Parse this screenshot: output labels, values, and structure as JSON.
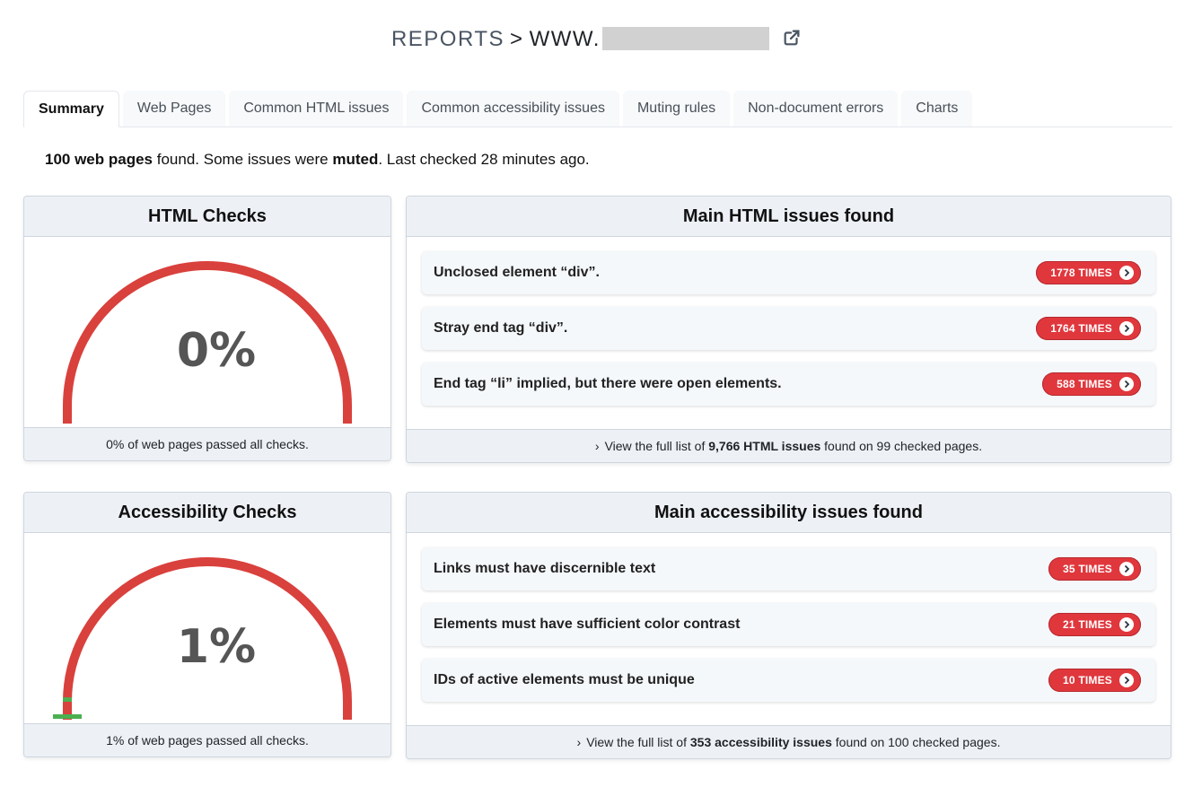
{
  "header": {
    "breadcrumb_root": "REPORTS",
    "separator": ">",
    "host_prefix": "WWW.",
    "external_link_icon": "external-link-icon"
  },
  "tabs": [
    {
      "label": "Summary",
      "active": true
    },
    {
      "label": "Web Pages",
      "active": false
    },
    {
      "label": "Common HTML issues",
      "active": false
    },
    {
      "label": "Common accessibility issues",
      "active": false
    },
    {
      "label": "Muting rules",
      "active": false
    },
    {
      "label": "Non-document errors",
      "active": false
    },
    {
      "label": "Charts",
      "active": false
    }
  ],
  "summary": {
    "pages_count": "100 web pages",
    "found": " found. Some issues were ",
    "muted": "muted",
    "last_checked": ". Last checked 28 minutes ago."
  },
  "colors": {
    "fail": "#d9413d",
    "pass": "#4caf50",
    "badge": "#e0373d",
    "gauge_text": "#555555"
  },
  "html_checks": {
    "title": "HTML Checks",
    "percent_label": "0%",
    "pass_fraction": 0.0,
    "footer": "0% of web pages passed all checks."
  },
  "accessibility_checks": {
    "title": "Accessibility Checks",
    "percent_label": "1%",
    "pass_fraction": 0.01,
    "footer": "1% of web pages passed all checks."
  },
  "html_issues": {
    "title": "Main HTML issues found",
    "items": [
      {
        "text": "Unclosed element “div”.",
        "count": "1778 TIMES"
      },
      {
        "text": "Stray end tag “div”.",
        "count": "1764 TIMES"
      },
      {
        "text": "End tag “li” implied, but there were open elements.",
        "count": "588 TIMES"
      }
    ],
    "footer_prefix": "View the full list of ",
    "footer_bold": "9,766 HTML issues",
    "footer_suffix": " found on 99 checked pages."
  },
  "accessibility_issues": {
    "title": "Main accessibility issues found",
    "items": [
      {
        "text": "Links must have discernible text",
        "count": "35 TIMES"
      },
      {
        "text": "Elements must have sufficient color contrast",
        "count": "21 TIMES"
      },
      {
        "text": "IDs of active elements must be unique",
        "count": "10 TIMES"
      }
    ],
    "footer_prefix": "View the full list of ",
    "footer_bold": "353 accessibility issues",
    "footer_suffix": " found on 100 checked pages."
  }
}
